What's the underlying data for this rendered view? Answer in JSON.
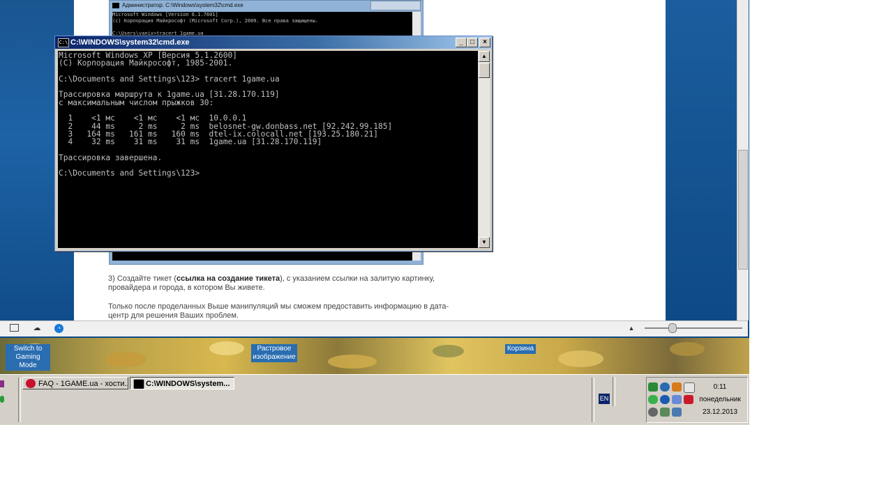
{
  "browser": {
    "page_text": {
      "p1_start": "3) Создайте тикет (",
      "p1_bold": "ссылка на создание тикета",
      "p1_end": "), с указанием ссылки на залитую картинку,",
      "p1_line2": "провайдера и города, в котором Вы живете.",
      "p2_line1": "Только после проделанных Выше манипуляций мы сможем предоставить информацию в дата-",
      "p2_line2": "центр для решения Ваших проблем."
    },
    "embedded_win7_cmd": {
      "title": "Администратор: C:\\Windows\\system32\\cmd.exe",
      "lines": "Microsoft Windows [Version 6.1.7601]\n(c) Корпорация Майкрософт (Microsoft Corp.), 2009. Все права защищены.\n\nC:\\Users\\vanix>tracert 1game.ua"
    }
  },
  "cmd_window": {
    "title": "C:\\WINDOWS\\system32\\cmd.exe",
    "icon_label": "C:\\",
    "buttons": {
      "minimize": "_",
      "maximize": "□",
      "close": "×"
    },
    "console_text": "Microsoft Windows XP [Версия 5.1.2600]\n(С) Корпорация Майкрософт, 1985-2001.\n\nC:\\Documents and Settings\\123> tracert 1game.ua\n\nТрассировка маршрута к 1game.ua [31.28.170.119]\nс максимальным числом прыжков 30:\n\n  1    <1 мс    <1 мс    <1 мс  10.0.0.1\n  2    44 ms     2 ms     2 ms  belosnet-gw.donbass.net [92.242.99.185]\n  3   164 ms   161 ms   160 ms  dtel-ix.colocall.net [193.25.180.21]\n  4    32 ms    31 ms    31 ms  1game.ua [31.28.170.119]\n\nТрассировка завершена.\n\nC:\\Documents and Settings\\123>"
  },
  "desktop_icons": [
    {
      "label": "Switch to Gaming Mode"
    },
    {
      "label": "Растровое изображение"
    },
    {
      "label": "Корзина"
    }
  ],
  "taskbar": {
    "tasks": [
      {
        "label": "FAQ - 1GAME.ua - хости...",
        "active": false
      },
      {
        "label": "C:\\WINDOWS\\system...",
        "active": true
      }
    ],
    "language": "EN",
    "clock": {
      "time": "0:11",
      "day": "понедельник",
      "date": "23.12.2013"
    }
  },
  "colors": {
    "xp_title_start": "#0a246a",
    "console_bg": "#000000",
    "console_fg": "#c0c0c0",
    "taskbar": "#d4d0c8"
  }
}
